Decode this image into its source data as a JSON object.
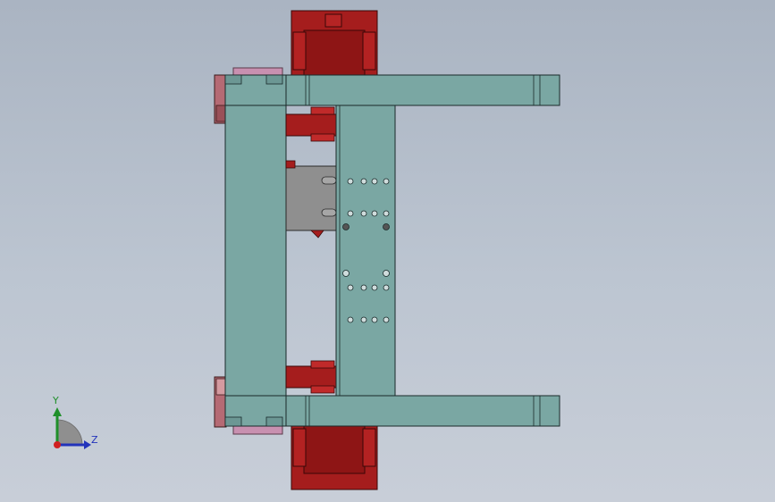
{
  "view": {
    "background_top": "#aab4c2",
    "background_bottom": "#c8ced8"
  },
  "triad": {
    "y_label": "Y",
    "z_label": "Z",
    "y_color": "#1f8f2a",
    "z_color": "#2233bb",
    "origin_color": "#d02020"
  },
  "model": {
    "frame_color": "#7aa7a3",
    "motor_color": "#a51d1d",
    "pad_color": "#c890b0",
    "bracket_color": "#8f8f8f",
    "edge_color": "#1a2a2a"
  }
}
